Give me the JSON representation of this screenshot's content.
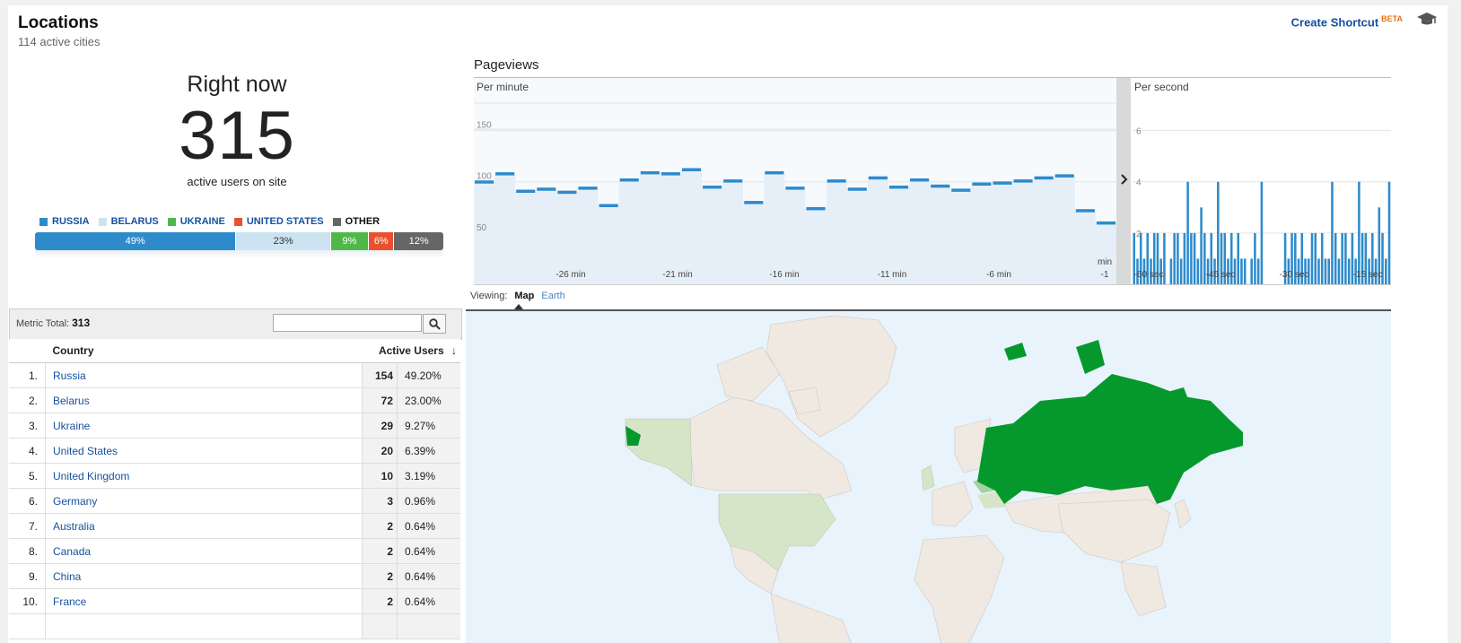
{
  "header": {
    "title": "Locations",
    "subtitle": "114 active cities",
    "shortcut_label": "Create Shortcut",
    "shortcut_badge": "BETA"
  },
  "right_now": {
    "label": "Right now",
    "count": "315",
    "sublabel": "active users on site",
    "legend": [
      {
        "label": "RUSSIA",
        "color": "#2e8bcb",
        "text_color": "#15519f"
      },
      {
        "label": "BELARUS",
        "color": "#cce3f2",
        "text_color": "#15519f"
      },
      {
        "label": "UKRAINE",
        "color": "#50b848",
        "text_color": "#15519f"
      },
      {
        "label": "UNITED STATES",
        "color": "#e8512c",
        "text_color": "#15519f"
      },
      {
        "label": "OTHER",
        "color": "#666666",
        "text_color": "#111111"
      }
    ],
    "segments": [
      {
        "label": "49%",
        "share": 49,
        "color": "#2e8bcb",
        "text": "#ffffff"
      },
      {
        "label": "23%",
        "share": 23,
        "color": "#cce3f2",
        "text": "#333333"
      },
      {
        "label": "9%",
        "share": 9,
        "color": "#50b848",
        "text": "#ffffff"
      },
      {
        "label": "6%",
        "share": 6,
        "color": "#e8512c",
        "text": "#ffffff"
      },
      {
        "label": "12%",
        "share": 12,
        "color": "#666666",
        "text": "#ffffff"
      }
    ]
  },
  "pageviews": {
    "title": "Pageviews",
    "per_minute_label": "Per minute",
    "per_second_label": "Per second"
  },
  "chart_data": [
    {
      "type": "area",
      "title": "Per minute",
      "y_ticks": [
        "150",
        "100",
        "50"
      ],
      "ylim": [
        0,
        175
      ],
      "x_ticks": [
        "-26 min",
        "-21 min",
        "-16 min",
        "-11 min",
        "-6 min",
        "min -1"
      ],
      "x": [
        -30,
        -29,
        -28,
        -27,
        -26,
        -25,
        -24,
        -23,
        -22,
        -21,
        -20,
        -19,
        -18,
        -17,
        -16,
        -15,
        -14,
        -13,
        -12,
        -11,
        -10,
        -9,
        -8,
        -7,
        -6,
        -5,
        -4,
        -3,
        -2,
        -1,
        0
      ],
      "values": [
        100,
        108,
        91,
        93,
        90,
        94,
        77,
        102,
        109,
        108,
        112,
        95,
        101,
        80,
        109,
        94,
        74,
        101,
        93,
        104,
        95,
        102,
        96,
        92,
        98,
        99,
        101,
        104,
        106,
        72,
        60
      ]
    },
    {
      "type": "bar",
      "title": "Per second",
      "y_ticks": [
        "6",
        "4",
        "2"
      ],
      "ylim": [
        0,
        7
      ],
      "x_ticks": [
        "-60 sec",
        "-45 sec",
        "-30 sec",
        "-15 sec"
      ],
      "values": [
        2,
        1,
        2,
        1,
        2,
        1,
        2,
        2,
        1,
        2,
        0,
        1,
        2,
        2,
        1,
        2,
        4,
        2,
        2,
        1,
        3,
        2,
        1,
        2,
        1,
        4,
        2,
        2,
        1,
        2,
        1,
        2,
        1,
        1,
        0,
        1,
        2,
        1,
        4,
        0,
        0,
        0,
        0,
        0,
        0,
        2,
        1,
        2,
        2,
        1,
        2,
        1,
        1,
        2,
        2,
        1,
        2,
        1,
        1,
        4,
        2,
        1,
        2,
        2,
        1,
        2,
        1,
        4,
        2,
        2,
        1,
        2,
        1,
        3,
        2,
        1,
        4
      ]
    }
  ],
  "viewing": {
    "label": "Viewing:",
    "map": "Map",
    "earth": "Earth"
  },
  "table": {
    "metric_total_label": "Metric Total:",
    "metric_total": "313",
    "col_country": "Country",
    "col_users": "Active Users",
    "rows": [
      {
        "idx": "1.",
        "country": "Russia",
        "users": "154",
        "pct": "49.20%"
      },
      {
        "idx": "2.",
        "country": "Belarus",
        "users": "72",
        "pct": "23.00%"
      },
      {
        "idx": "3.",
        "country": "Ukraine",
        "users": "29",
        "pct": "9.27%"
      },
      {
        "idx": "4.",
        "country": "United States",
        "users": "20",
        "pct": "6.39%"
      },
      {
        "idx": "5.",
        "country": "United Kingdom",
        "users": "10",
        "pct": "3.19%"
      },
      {
        "idx": "6.",
        "country": "Germany",
        "users": "3",
        "pct": "0.96%"
      },
      {
        "idx": "7.",
        "country": "Australia",
        "users": "2",
        "pct": "0.64%"
      },
      {
        "idx": "8.",
        "country": "Canada",
        "users": "2",
        "pct": "0.64%"
      },
      {
        "idx": "9.",
        "country": "China",
        "users": "2",
        "pct": "0.64%"
      },
      {
        "idx": "10.",
        "country": "France",
        "users": "2",
        "pct": "0.64%"
      }
    ]
  },
  "map_colors": {
    "ocean": "#e8f3fb",
    "land": "#efe9e2",
    "high": "#05992d",
    "medium": "#a6d2a0",
    "low": "#d6e4c8"
  }
}
